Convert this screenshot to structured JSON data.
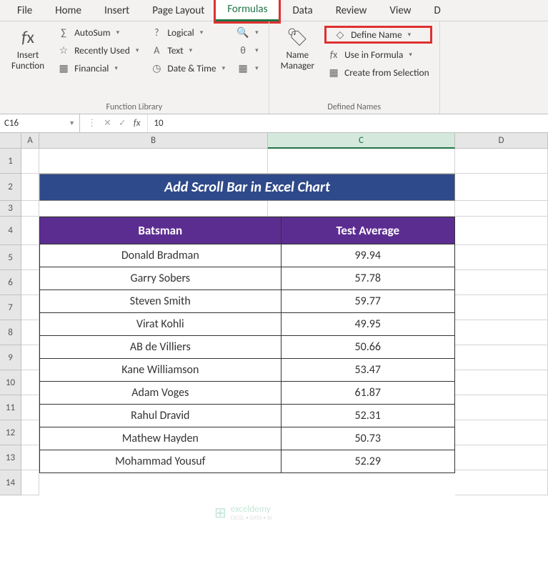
{
  "tabs": {
    "file": "File",
    "home": "Home",
    "insert": "Insert",
    "page_layout": "Page Layout",
    "formulas": "Formulas",
    "data": "Data",
    "review": "Review",
    "view": "View",
    "d": "D"
  },
  "ribbon": {
    "insert_function": "Insert\nFunction",
    "autosum": "AutoSum",
    "recently_used": "Recently Used",
    "financial": "Financial",
    "logical": "Logical",
    "text": "Text",
    "date_time": "Date & Time",
    "name_manager": "Name\nManager",
    "define_name": "Define Name",
    "use_in_formula": "Use in Formula",
    "create_from_selection": "Create from Selection",
    "group_function_library": "Function Library",
    "group_defined_names": "Defined Names"
  },
  "namebox": "C16",
  "formula_value": "10",
  "fx_label": "fx",
  "columns": {
    "a": "A",
    "b": "B",
    "c": "C",
    "d": "D"
  },
  "rows": [
    "1",
    "2",
    "3",
    "4",
    "5",
    "6",
    "7",
    "8",
    "9",
    "10",
    "11",
    "12",
    "13",
    "14"
  ],
  "banner_title": "Add Scroll Bar in Excel Chart",
  "table": {
    "headers": {
      "batsman": "Batsman",
      "avg": "Test Average"
    },
    "rows": [
      {
        "name": "Donald Bradman",
        "avg": "99.94"
      },
      {
        "name": "Garry Sobers",
        "avg": "57.78"
      },
      {
        "name": "Steven Smith",
        "avg": "59.77"
      },
      {
        "name": "Virat Kohli",
        "avg": "49.95"
      },
      {
        "name": "AB de Villiers",
        "avg": "50.66"
      },
      {
        "name": "Kane Williamson",
        "avg": "53.47"
      },
      {
        "name": "Adam Voges",
        "avg": "61.87"
      },
      {
        "name": "Rahul Dravid",
        "avg": "52.31"
      },
      {
        "name": "Mathew Hayden",
        "avg": "50.73"
      },
      {
        "name": "Mohammad Yousuf",
        "avg": "52.29"
      }
    ]
  },
  "watermark": {
    "brand": "exceldemy",
    "sub": "EXCEL • DATA • BI"
  }
}
